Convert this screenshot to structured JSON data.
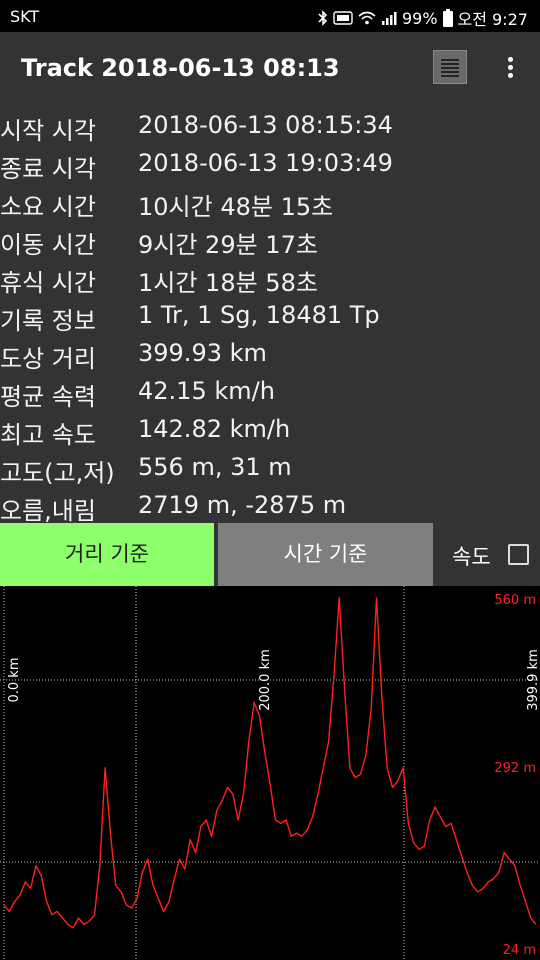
{
  "status_bar": {
    "carrier": "SKT",
    "battery": "99%",
    "time": "오전 9:27"
  },
  "app_bar": {
    "title": "Track 2018-06-13 08:13",
    "list_icon": "list-icon",
    "more_icon": "more-vert-icon"
  },
  "info": [
    {
      "label": "시작 시각",
      "value": "2018-06-13 08:15:34"
    },
    {
      "label": "종료 시각",
      "value": "2018-06-13 19:03:49"
    },
    {
      "label": "소요 시간",
      "value": "10시간 48분 15초"
    },
    {
      "label": "이동 시간",
      "value": "9시간 29분 17초"
    },
    {
      "label": "휴식 시간",
      "value": "1시간 18분 58초"
    },
    {
      "label": "기록 정보",
      "value": "1 Tr, 1 Sg, 18481 Tp"
    },
    {
      "label": "도상 거리",
      "value": "399.93 km"
    },
    {
      "label": "평균 속력",
      "value": "42.15 km/h"
    },
    {
      "label": "최고 속도",
      "value": "142.82 km/h"
    },
    {
      "label": "고도(고,저)",
      "value": "556 m, 31 m"
    },
    {
      "label": "오름,내림",
      "value": "2719 m, -2875 m"
    }
  ],
  "tabs": {
    "distance": "거리 기준",
    "time": "시간 기준",
    "speed_label": "속도",
    "speed_checked": false
  },
  "colors": {
    "accent_green": "#8cff6a",
    "line_red": "#ff2020",
    "grid": "#cccccc"
  },
  "chart_data": {
    "type": "line",
    "x_axis_labels": [
      "0.0 km",
      "200.0 km",
      "399.9 km"
    ],
    "y_axis_labels": [
      "560 m",
      "292 m",
      "24 m"
    ],
    "xlim": [
      0,
      399.9
    ],
    "ylim": [
      24,
      560
    ],
    "grid": true,
    "series": [
      {
        "x": [
          0,
          4,
          8,
          12,
          16,
          20,
          24,
          28,
          32,
          36,
          40,
          44,
          48,
          52,
          56,
          60,
          64,
          68,
          72,
          76,
          80,
          84,
          88,
          92,
          96,
          100,
          104,
          108,
          112,
          116,
          120,
          124,
          128,
          132,
          136,
          140,
          144,
          148,
          152,
          156,
          160,
          164,
          168,
          172,
          176,
          180,
          184,
          188,
          192,
          196,
          200,
          204,
          208,
          212,
          216,
          220,
          224,
          228,
          232,
          236,
          240,
          244,
          248,
          252,
          256,
          260,
          264,
          268,
          272,
          276,
          280,
          284,
          288,
          292,
          296,
          300,
          304,
          308,
          312,
          316,
          320,
          324,
          328,
          332,
          336,
          340,
          344,
          348,
          352,
          356,
          360,
          364,
          368,
          372,
          376,
          380,
          384,
          388,
          392,
          396,
          399.9
        ],
        "y": [
          90,
          80,
          95,
          105,
          125,
          115,
          150,
          135,
          95,
          75,
          80,
          70,
          60,
          55,
          70,
          60,
          65,
          75,
          150,
          300,
          200,
          120,
          110,
          90,
          85,
          100,
          140,
          160,
          120,
          100,
          80,
          95,
          130,
          160,
          145,
          190,
          170,
          210,
          220,
          195,
          235,
          250,
          270,
          260,
          220,
          260,
          340,
          400,
          380,
          325,
          275,
          220,
          215,
          220,
          195,
          200,
          195,
          205,
          225,
          260,
          300,
          340,
          440,
          560,
          420,
          300,
          285,
          290,
          320,
          390,
          560,
          410,
          300,
          270,
          280,
          300,
          215,
          185,
          175,
          180,
          220,
          240,
          225,
          210,
          215,
          190,
          165,
          140,
          120,
          110,
          115,
          125,
          130,
          140,
          170,
          160,
          150,
          120,
          95,
          70,
          60
        ]
      }
    ]
  }
}
